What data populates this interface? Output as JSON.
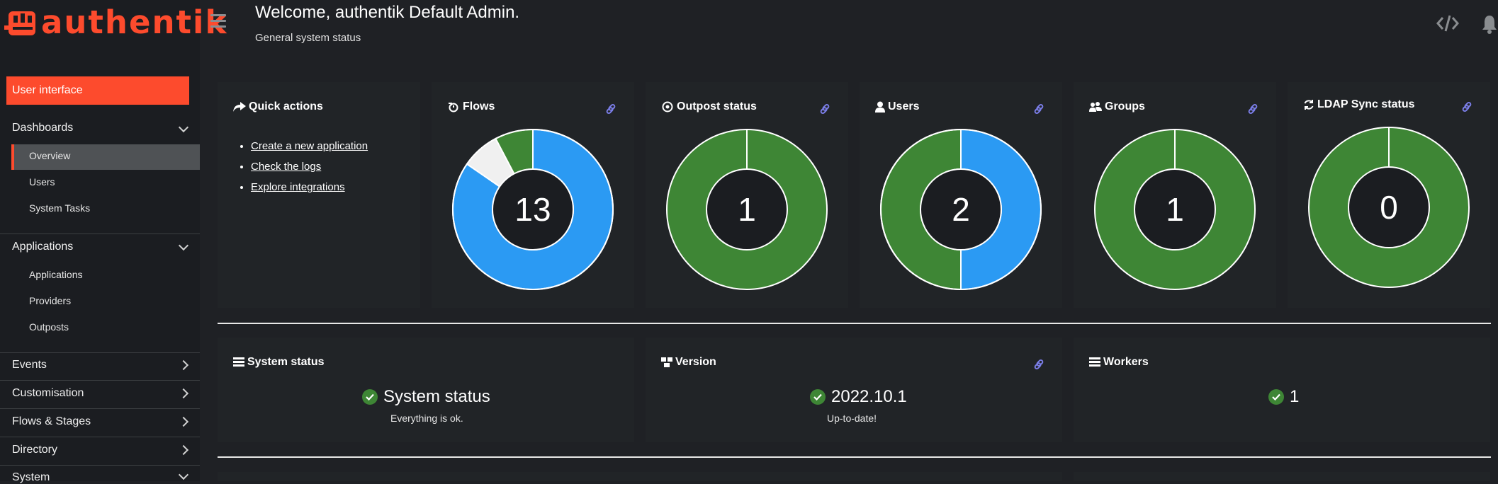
{
  "brand": {
    "name": "authentik"
  },
  "header": {
    "title": "Welcome, authentik Default Admin.",
    "subtitle": "General system status"
  },
  "sidebar": {
    "user_interface_label": "User interface",
    "groups": [
      {
        "label": "Dashboards",
        "expanded": true,
        "items": [
          "Overview",
          "Users",
          "System Tasks"
        ]
      },
      {
        "label": "Applications",
        "expanded": true,
        "items": [
          "Applications",
          "Providers",
          "Outposts"
        ]
      },
      {
        "label": "Events",
        "expanded": false,
        "items": []
      },
      {
        "label": "Customisation",
        "expanded": false,
        "items": []
      },
      {
        "label": "Flows & Stages",
        "expanded": false,
        "items": []
      },
      {
        "label": "Directory",
        "expanded": false,
        "items": []
      },
      {
        "label": "System",
        "expanded": true,
        "items": []
      }
    ],
    "active_item": "Overview"
  },
  "quick_actions": {
    "title": "Quick actions",
    "links": [
      "Create a new application",
      "Check the logs",
      "Explore integrations"
    ]
  },
  "cards": [
    {
      "title": "Flows",
      "icon": "flows-icon",
      "value": "13",
      "chart_data": {
        "type": "pie",
        "values": [
          11,
          1,
          1
        ],
        "colors": [
          "#2b9af3",
          "#f0f0f0",
          "#3e8635"
        ]
      }
    },
    {
      "title": "Outpost status",
      "icon": "outpost-icon",
      "value": "1",
      "chart_data": {
        "type": "pie",
        "values": [
          1
        ],
        "colors": [
          "#3e8635"
        ]
      }
    },
    {
      "title": "Users",
      "icon": "user-icon",
      "value": "2",
      "chart_data": {
        "type": "pie",
        "values": [
          1,
          1
        ],
        "colors": [
          "#2b9af3",
          "#3e8635"
        ]
      }
    },
    {
      "title": "Groups",
      "icon": "groups-icon",
      "value": "1",
      "chart_data": {
        "type": "pie",
        "values": [
          1
        ],
        "colors": [
          "#3e8635"
        ]
      }
    },
    {
      "title": "LDAP Sync status",
      "icon": "sync-icon",
      "value": "0",
      "chart_data": {
        "type": "pie",
        "values": [
          1
        ],
        "colors": [
          "#3e8635"
        ]
      }
    }
  ],
  "status_cards": [
    {
      "title": "System status",
      "value": "System status",
      "sub": "Everything is ok."
    },
    {
      "title": "Version",
      "value": "2022.10.1",
      "sub": "Up-to-date!"
    },
    {
      "title": "Workers",
      "value": "1",
      "sub": ""
    }
  ],
  "colors": {
    "accent": "#fd4b2d",
    "success": "#3e8635",
    "info": "#2b9af3",
    "link_icon": "#7b7ee8"
  }
}
